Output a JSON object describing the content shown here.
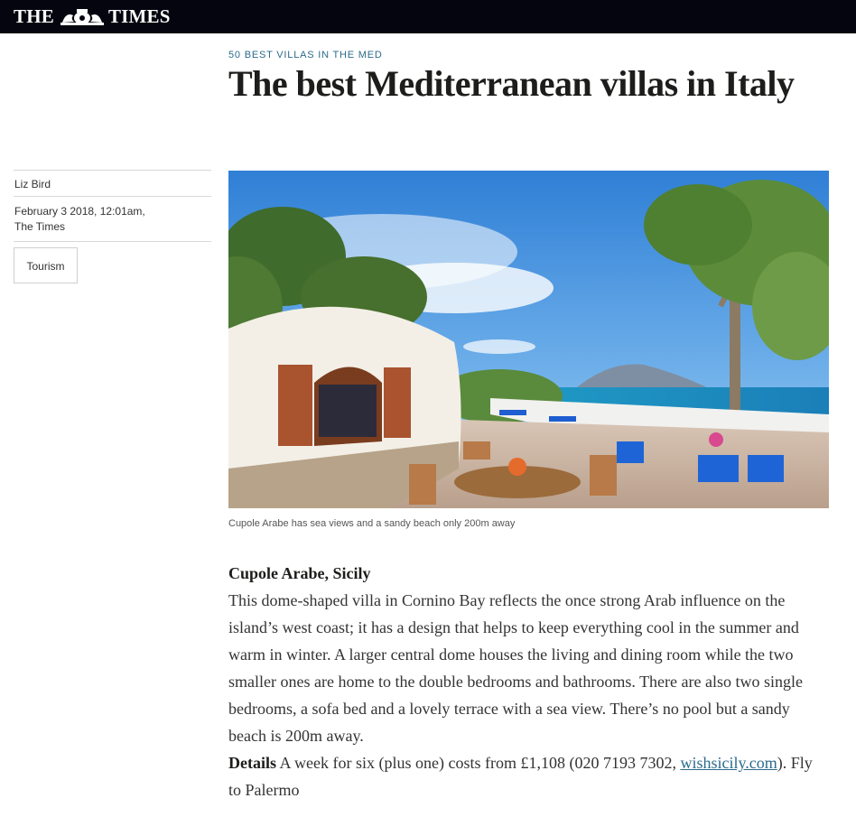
{
  "masthead": {
    "logo_left": "THE",
    "logo_right": "TIMES",
    "crest_icon": "royal-crest-icon",
    "background": "#04050f"
  },
  "article": {
    "flag": "50 BEST VILLAS IN THE MED",
    "headline": "The best Mediterranean villas in Italy",
    "byline": {
      "author": "Liz Bird",
      "date": "February 3 2018, 12:01am,",
      "publication": "The Times"
    },
    "tag": "Tourism",
    "image_caption": "Cupole Arabe has sea views and a sandy beach only 200m away",
    "section": {
      "subhead": "Cupole Arabe, Sicily",
      "paragraph": "This dome-shaped villa in Cornino Bay reflects the once strong Arab influence on the island’s west coast; it has a design that helps to keep everything cool in the summer and warm in winter. A larger central dome houses the living and dining room while the two smaller ones are home to the double bedrooms and bathrooms. There are also two single bedrooms, a sofa bed and a lovely terrace with a sea view. There’s no pool but a sandy beach is 200m away.",
      "details_label": "Details",
      "details_text": " A week for six (plus one) costs from £1,108 (020 7193 7302, ",
      "details_link": "wishsicily.com",
      "details_end": "). Fly to Palermo"
    }
  },
  "colors": {
    "accent": "#2b6b8c",
    "text": "#1d1d1b"
  }
}
